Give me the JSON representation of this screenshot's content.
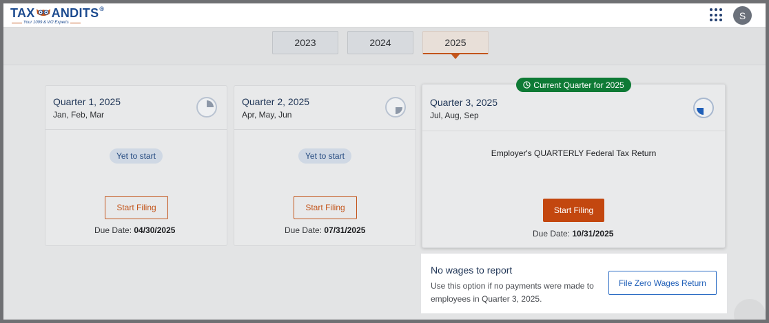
{
  "header": {
    "logo_text_left": "TAX",
    "logo_text_right": "ANDITS",
    "logo_reg": "®",
    "logo_tagline": "Your 1099 & W2 Experts",
    "avatar_initial": "S"
  },
  "years": {
    "tabs": [
      "2023",
      "2024",
      "2025"
    ],
    "active": "2025"
  },
  "quarters": [
    {
      "title": "Quarter 1, 2025",
      "months": "Jan, Feb, Mar",
      "status": "Yet to start",
      "button": "Start Filing",
      "due_label": "Due Date:",
      "due_date": "04/30/2025",
      "pie_fraction": 0.25
    },
    {
      "title": "Quarter 2, 2025",
      "months": "Apr, May, Jun",
      "status": "Yet to start",
      "button": "Start Filing",
      "due_label": "Due Date:",
      "due_date": "07/31/2025",
      "pie_fraction": 0.25
    },
    {
      "title": "Quarter 3, 2025",
      "months": "Jul, Aug, Sep",
      "badge": "Current Quarter for 2025",
      "form_title": "Employer's QUARTERLY Federal Tax Return",
      "button": "Start Filing",
      "due_label": "Due Date:",
      "due_date": "10/31/2025",
      "pie_fraction": 0.25
    }
  ],
  "zero_wages": {
    "title": "No wages to report",
    "description": "Use this option if no payments were made to employees in Quarter 3, 2025.",
    "button": "File Zero Wages Return"
  },
  "colors": {
    "brand_blue": "#1d4b8f",
    "accent_orange": "#c3551b",
    "current_green": "#0e7a35"
  }
}
